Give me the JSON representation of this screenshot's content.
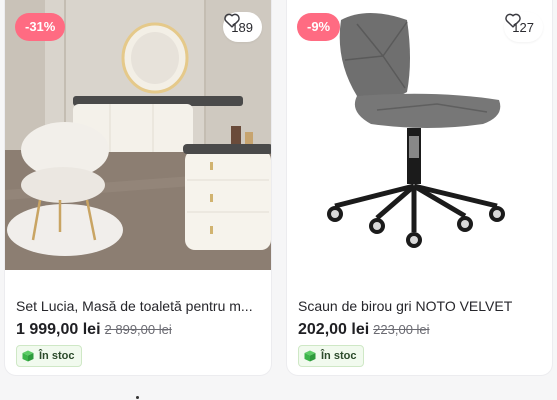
{
  "products": [
    {
      "discount": "-31%",
      "favorites": "189",
      "title": "Set Lucia, Masă de toaletă pentru m...",
      "price": "1 999,00 lei",
      "old_price": "2 899,00 lei",
      "stock": "În stoc"
    },
    {
      "discount": "-9%",
      "favorites": "127",
      "title": "Scaun de birou gri NOTO VELVET",
      "price": "202,00 lei",
      "old_price": "223,00 lei",
      "stock": "În stoc"
    }
  ],
  "colors": {
    "discount_badge": "#ff6b82",
    "stock_badge_bg": "#f1faee",
    "stock_icon": "#3cb54a",
    "page_bg": "#f6f6f7"
  },
  "icons": {
    "favorite": "heart-icon",
    "stock": "box-icon"
  }
}
